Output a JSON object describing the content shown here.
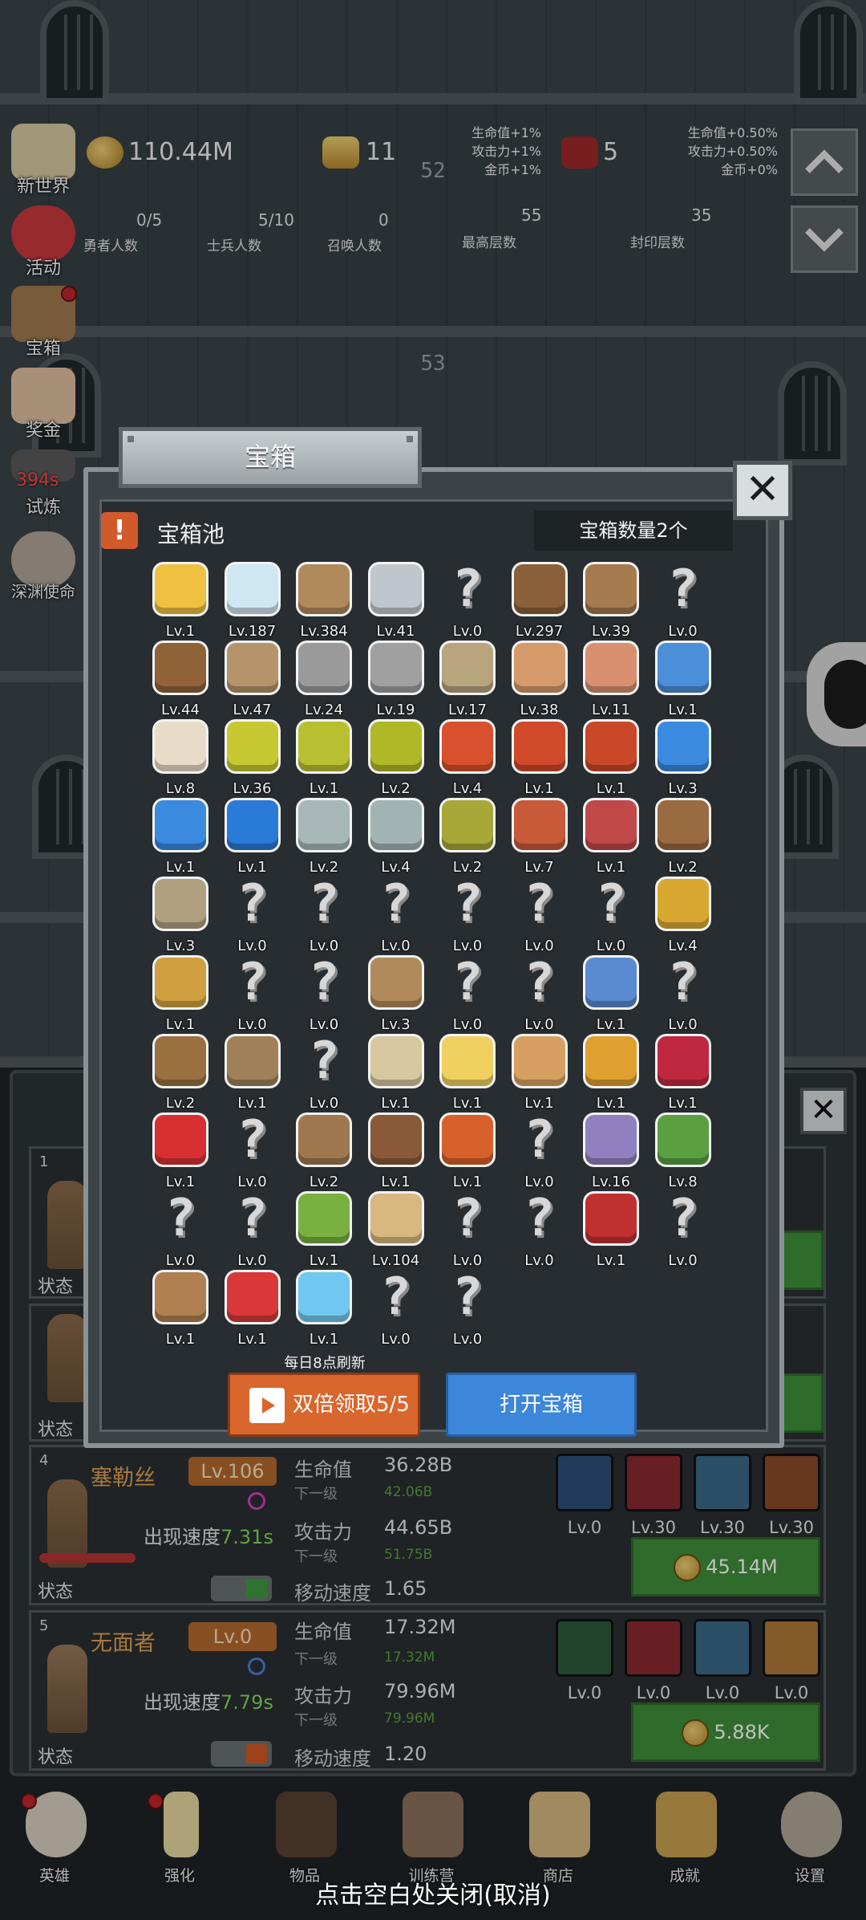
{
  "top_stats": {
    "gold": "110.44M",
    "bars": "11",
    "gems": "5",
    "center_floor": "52",
    "bonus_left": [
      "生命值+1%",
      "攻击力+1%",
      "金币+1%"
    ],
    "bonus_right": [
      "生命值+0.50%",
      "攻击力+0.50%",
      "金币+0%"
    ],
    "heroes": {
      "value": "0/5",
      "label": "勇者人数"
    },
    "soldiers": {
      "value": "5/10",
      "label": "士兵人数"
    },
    "summons": {
      "value": "0",
      "label": "召唤人数"
    },
    "max_floor": {
      "value": "55",
      "label": "最高层数"
    },
    "sealed_floor": {
      "value": "35",
      "label": "封印层数"
    },
    "floor_53": "53"
  },
  "side_menu": [
    {
      "label": "新世界",
      "color": "#d8c9a0"
    },
    {
      "label": "活动",
      "color": "#c8383c"
    },
    {
      "label": "宝箱",
      "color": "#a07a4e"
    },
    {
      "label": "奖金",
      "color": "#e0c0a0"
    },
    {
      "label": "试炼",
      "timer": "394s",
      "color": "#5a5a5a"
    },
    {
      "label": "深渊使命",
      "color": "#b0a69a"
    }
  ],
  "dialog": {
    "title": "宝箱",
    "pool_label": "宝箱池",
    "chest_count": "宝箱数量2个",
    "refresh_note": "每日8点刷新",
    "double_button": "双倍领取5/5",
    "open_button": "打开宝箱",
    "close_icon": "close-icon",
    "items": [
      {
        "lv": "Lv.1",
        "icon": "crown",
        "color": "#f0c040"
      },
      {
        "lv": "Lv.187",
        "icon": "diamond",
        "color": "#cfe6f3"
      },
      {
        "lv": "Lv.384",
        "icon": "wooden-sword",
        "color": "#b08a5a"
      },
      {
        "lv": "Lv.41",
        "icon": "iron-sword",
        "color": "#bfc7cc"
      },
      {
        "lv": "Lv.0",
        "icon": "unknown"
      },
      {
        "lv": "Lv.297",
        "icon": "leather-armor",
        "color": "#8a6038"
      },
      {
        "lv": "Lv.39",
        "icon": "backpack",
        "color": "#a47a4e"
      },
      {
        "lv": "Lv.0",
        "icon": "unknown"
      },
      {
        "lv": "Lv.44",
        "icon": "leather-helmet",
        "color": "#8f6238"
      },
      {
        "lv": "Lv.47",
        "icon": "dagger",
        "color": "#b49468"
      },
      {
        "lv": "Lv.24",
        "icon": "knight-helmet",
        "color": "#9a9a9a"
      },
      {
        "lv": "Lv.19",
        "icon": "hammer",
        "color": "#a0a0a0"
      },
      {
        "lv": "Lv.17",
        "icon": "great-helm",
        "color": "#b8a57e"
      },
      {
        "lv": "Lv.38",
        "icon": "ham",
        "color": "#d59a6a"
      },
      {
        "lv": "Lv.11",
        "icon": "steak",
        "color": "#d89070"
      },
      {
        "lv": "Lv.1",
        "icon": "blue-bag",
        "color": "#4a8fd8"
      },
      {
        "lv": "Lv.8",
        "icon": "bread",
        "color": "#e8dcc8"
      },
      {
        "lv": "Lv.36",
        "icon": "yellow-potion",
        "color": "#c8c832"
      },
      {
        "lv": "Lv.1",
        "icon": "yellow-potion",
        "color": "#b8c032"
      },
      {
        "lv": "Lv.2",
        "icon": "yellow-potion",
        "color": "#b0b828"
      },
      {
        "lv": "Lv.4",
        "icon": "red-potion",
        "color": "#d8502c"
      },
      {
        "lv": "Lv.1",
        "icon": "red-potion",
        "color": "#d04a2a"
      },
      {
        "lv": "Lv.1",
        "icon": "red-potion",
        "color": "#c84828"
      },
      {
        "lv": "Lv.3",
        "icon": "blue-potion",
        "color": "#3a8ae0"
      },
      {
        "lv": "Lv.1",
        "icon": "blue-potion",
        "color": "#3a8ae0"
      },
      {
        "lv": "Lv.1",
        "icon": "blue-potion",
        "color": "#2a7ad8"
      },
      {
        "lv": "Lv.2",
        "icon": "grey-potion",
        "color": "#a8b8b8"
      },
      {
        "lv": "Lv.4",
        "icon": "grey-potion",
        "color": "#a0b4b4"
      },
      {
        "lv": "Lv.2",
        "icon": "olive-potion",
        "color": "#a8a838"
      },
      {
        "lv": "Lv.7",
        "icon": "red-bottle",
        "color": "#c85a3a"
      },
      {
        "lv": "Lv.1",
        "icon": "winged-boot",
        "color": "#c04848"
      },
      {
        "lv": "Lv.2",
        "icon": "brown-boot",
        "color": "#9a6a40"
      },
      {
        "lv": "Lv.3",
        "icon": "cloth-boot",
        "color": "#b0a080"
      },
      {
        "lv": "Lv.0",
        "icon": "unknown"
      },
      {
        "lv": "Lv.0",
        "icon": "unknown"
      },
      {
        "lv": "Lv.0",
        "icon": "unknown"
      },
      {
        "lv": "Lv.0",
        "icon": "unknown"
      },
      {
        "lv": "Lv.0",
        "icon": "unknown"
      },
      {
        "lv": "Lv.0",
        "icon": "unknown"
      },
      {
        "lv": "Lv.4",
        "icon": "torch-staff",
        "color": "#d8a830"
      },
      {
        "lv": "Lv.1",
        "icon": "golden-staff",
        "color": "#d0a040"
      },
      {
        "lv": "Lv.0",
        "icon": "unknown"
      },
      {
        "lv": "Lv.0",
        "icon": "unknown"
      },
      {
        "lv": "Lv.3",
        "icon": "crook-staff",
        "color": "#b08a5a"
      },
      {
        "lv": "Lv.0",
        "icon": "unknown"
      },
      {
        "lv": "Lv.0",
        "icon": "unknown"
      },
      {
        "lv": "Lv.1",
        "icon": "blue-wand",
        "color": "#5a8ad0"
      },
      {
        "lv": "Lv.0",
        "icon": "unknown"
      },
      {
        "lv": "Lv.2",
        "icon": "leather-bag",
        "color": "#9a7040"
      },
      {
        "lv": "Lv.1",
        "icon": "shovel",
        "color": "#a08058"
      },
      {
        "lv": "Lv.0",
        "icon": "unknown"
      },
      {
        "lv": "Lv.1",
        "icon": "bone-club",
        "color": "#d8c8a0"
      },
      {
        "lv": "Lv.1",
        "icon": "cheese",
        "color": "#f0d060"
      },
      {
        "lv": "Lv.1",
        "icon": "pie",
        "color": "#d8a060"
      },
      {
        "lv": "Lv.1",
        "icon": "honey-jar",
        "color": "#e0a030"
      },
      {
        "lv": "Lv.1",
        "icon": "red-pyramid",
        "color": "#c02840"
      },
      {
        "lv": "Lv.1",
        "icon": "red-orb",
        "color": "#d83030"
      },
      {
        "lv": "Lv.0",
        "icon": "unknown"
      },
      {
        "lv": "Lv.2",
        "icon": "bow",
        "color": "#a07850"
      },
      {
        "lv": "Lv.1",
        "icon": "quiver",
        "color": "#8a5a38"
      },
      {
        "lv": "Lv.1",
        "icon": "fire-gauntlet",
        "color": "#d8602a"
      },
      {
        "lv": "Lv.0",
        "icon": "unknown"
      },
      {
        "lv": "Lv.16",
        "icon": "tentacle-charm",
        "color": "#9080c0"
      },
      {
        "lv": "Lv.8",
        "icon": "emerald-amulet",
        "color": "#5aa040"
      },
      {
        "lv": "Lv.0",
        "icon": "unknown"
      },
      {
        "lv": "Lv.0",
        "icon": "unknown"
      },
      {
        "lv": "Lv.1",
        "icon": "green-scepter",
        "color": "#7ab040"
      },
      {
        "lv": "Lv.104",
        "icon": "beer-mug",
        "color": "#d8b880"
      },
      {
        "lv": "Lv.0",
        "icon": "unknown"
      },
      {
        "lv": "Lv.0",
        "icon": "unknown"
      },
      {
        "lv": "Lv.1",
        "icon": "red-book",
        "color": "#c03030"
      },
      {
        "lv": "Lv.0",
        "icon": "unknown"
      },
      {
        "lv": "Lv.1",
        "icon": "whip",
        "color": "#b08050"
      },
      {
        "lv": "Lv.1",
        "icon": "fire-card",
        "color": "#d83838"
      },
      {
        "lv": "Lv.1",
        "icon": "crystal-ball",
        "color": "#70c8f0"
      },
      {
        "lv": "Lv.0",
        "icon": "unknown"
      },
      {
        "lv": "Lv.0",
        "icon": "unknown"
      }
    ]
  },
  "heroes": [
    {
      "index": "1",
      "state": "状态"
    },
    {
      "state": "状态"
    },
    {
      "index": "4",
      "name": "塞勒丝",
      "lv": "Lv.106",
      "speed_label": "出现速度",
      "speed": "7.31s",
      "hp_label": "生命值",
      "hp": "36.28B",
      "hp_next_label": "下一级",
      "hp_next": "42.06B",
      "atk_label": "攻击力",
      "atk": "44.65B",
      "atk_next_label": "下一级",
      "atk_next": "51.75B",
      "move_label": "移动速度",
      "move": "1.65",
      "state": "状态",
      "toggle_color": "#3e9a3e",
      "skills": [
        {
          "lv": "Lv.0",
          "icon": "shield-star-icon",
          "color": "#2f4f78"
        },
        {
          "lv": "Lv.30",
          "icon": "demon-face-icon",
          "color": "#8a2a30"
        },
        {
          "lv": "Lv.30",
          "icon": "armor-chest-icon",
          "color": "#3a6a88"
        },
        {
          "lv": "Lv.30",
          "icon": "dungeon-door-icon",
          "color": "#8a4a28"
        }
      ],
      "cost": "45.14M"
    },
    {
      "index": "5",
      "name": "无面者",
      "lv": "Lv.0",
      "speed_label": "出现速度",
      "speed": "7.79s",
      "hp_label": "生命值",
      "hp": "17.32M",
      "hp_next_label": "下一级",
      "hp_next": "17.32M",
      "atk_label": "攻击力",
      "atk": "79.96M",
      "atk_next_label": "下一级",
      "atk_next": "79.96M",
      "move_label": "移动速度",
      "move": "1.20",
      "state": "状态",
      "toggle_color": "#d05a24",
      "skills": [
        {
          "lv": "Lv.0",
          "icon": "crossed-sword-icon",
          "color": "#2e5a3a"
        },
        {
          "lv": "Lv.0",
          "icon": "red-sword-icon",
          "color": "#8a2a30"
        },
        {
          "lv": "Lv.0",
          "icon": "cannon-icon",
          "color": "#3a6a88"
        },
        {
          "lv": "Lv.0",
          "icon": "helmet-face-icon",
          "color": "#b07838"
        }
      ],
      "cost": "5.88K"
    }
  ],
  "bottom_nav": [
    {
      "label": "英雄",
      "color": "#d8d0c0",
      "dot": true
    },
    {
      "label": "强化",
      "color": "#e8d8a0",
      "dot": true
    },
    {
      "label": "物品",
      "color": "#5a4030"
    },
    {
      "label": "训练营",
      "color": "#8a7058"
    },
    {
      "label": "商店",
      "color": "#d8b880"
    },
    {
      "label": "成就",
      "color": "#c8a050"
    },
    {
      "label": "设置",
      "color": "#b0a898"
    }
  ],
  "close_hint": "点击空白处关闭(取消)"
}
